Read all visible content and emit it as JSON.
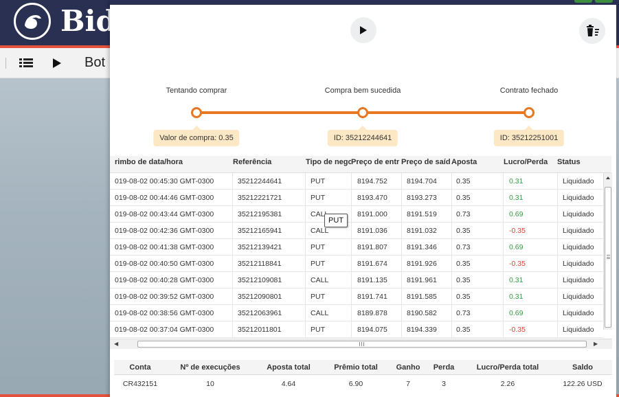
{
  "app": {
    "brand": "Bid",
    "toolbar_label": "Bot",
    "icons": {
      "logo": "bull-logo-icon",
      "list": "list-icon",
      "play": "play-icon"
    }
  },
  "dialog": {
    "icons": {
      "run": "play-icon",
      "clear": "trash-clear-icon"
    }
  },
  "stepper": {
    "steps": [
      {
        "title": "Tentando comprar",
        "info": "Valor de compra: 0.35"
      },
      {
        "title": "Compra bem sucedida",
        "info": "ID: 35212244641"
      },
      {
        "title": "Contrato fechado",
        "info": "ID: 35212251001"
      }
    ],
    "color": "#e87722",
    "info_bg": "#fce8c4"
  },
  "transactions": {
    "columns": [
      "rimbo de data/hora",
      "Referência",
      "Tipo de negc",
      "Preço de entr",
      "Preço de saíd",
      "Aposta",
      "Lucro/Perda",
      "Status"
    ],
    "rows": [
      {
        "time": "019-08-02 00:45:30 GMT-0300",
        "ref": "35212244641",
        "type": "PUT",
        "entry": "8194.752",
        "exit": "8194.704",
        "stake": "0.35",
        "pl": "0.31",
        "status": "Liquidado"
      },
      {
        "time": "019-08-02 00:44:46 GMT-0300",
        "ref": "35212221721",
        "type": "PUT",
        "entry": "8193.470",
        "exit": "8193.273",
        "stake": "0.35",
        "pl": "0.31",
        "status": "Liquidado"
      },
      {
        "time": "019-08-02 00:43:44 GMT-0300",
        "ref": "35212195381",
        "type": "CALL",
        "entry": "8191.000",
        "exit": "8191.519",
        "stake": "0.73",
        "pl": "0.69",
        "status": "Liquidado"
      },
      {
        "time": "019-08-02 00:42:36 GMT-0300",
        "ref": "35212165941",
        "type": "CALL",
        "entry": "8191.036",
        "exit": "8191.032",
        "stake": "0.35",
        "pl": "-0.35",
        "status": "Liquidado"
      },
      {
        "time": "019-08-02 00:41:38 GMT-0300",
        "ref": "35212139421",
        "type": "PUT",
        "entry": "8191.807",
        "exit": "8191.346",
        "stake": "0.73",
        "pl": "0.69",
        "status": "Liquidado"
      },
      {
        "time": "019-08-02 00:40:50 GMT-0300",
        "ref": "35212118841",
        "type": "PUT",
        "entry": "8191.674",
        "exit": "8191.926",
        "stake": "0.35",
        "pl": "-0.35",
        "status": "Liquidado"
      },
      {
        "time": "019-08-02 00:40:28 GMT-0300",
        "ref": "35212109081",
        "type": "CALL",
        "entry": "8191.135",
        "exit": "8191.961",
        "stake": "0.35",
        "pl": "0.31",
        "status": "Liquidado"
      },
      {
        "time": "019-08-02 00:39:52 GMT-0300",
        "ref": "35212090801",
        "type": "PUT",
        "entry": "8191.741",
        "exit": "8191.585",
        "stake": "0.35",
        "pl": "0.31",
        "status": "Liquidado"
      },
      {
        "time": "019-08-02 00:38:56 GMT-0300",
        "ref": "35212063961",
        "type": "CALL",
        "entry": "8189.878",
        "exit": "8190.582",
        "stake": "0.73",
        "pl": "0.69",
        "status": "Liquidado"
      },
      {
        "time": "019-08-02 00:37:04 GMT-0300",
        "ref": "35212011801",
        "type": "PUT",
        "entry": "8194.075",
        "exit": "8194.339",
        "stake": "0.35",
        "pl": "-0.35",
        "status": "Liquidado"
      }
    ],
    "positive_color": "#2e9e3b",
    "negative_color": "#e03c31"
  },
  "tooltip": {
    "text": "PUT"
  },
  "scrollbar": {
    "grip": "III"
  },
  "summary": {
    "columns": [
      "Conta",
      "Nº de execuções",
      "Aposta total",
      "Prêmio total",
      "Ganho",
      "Perda",
      "Lucro/Perda total",
      "Saldo"
    ],
    "values": {
      "account": "CR432151",
      "runs": "10",
      "total_stake": "4.64",
      "total_payout": "6.90",
      "wins": "7",
      "losses": "3",
      "total_pl": "2.26",
      "balance": "122.26 USD"
    }
  }
}
